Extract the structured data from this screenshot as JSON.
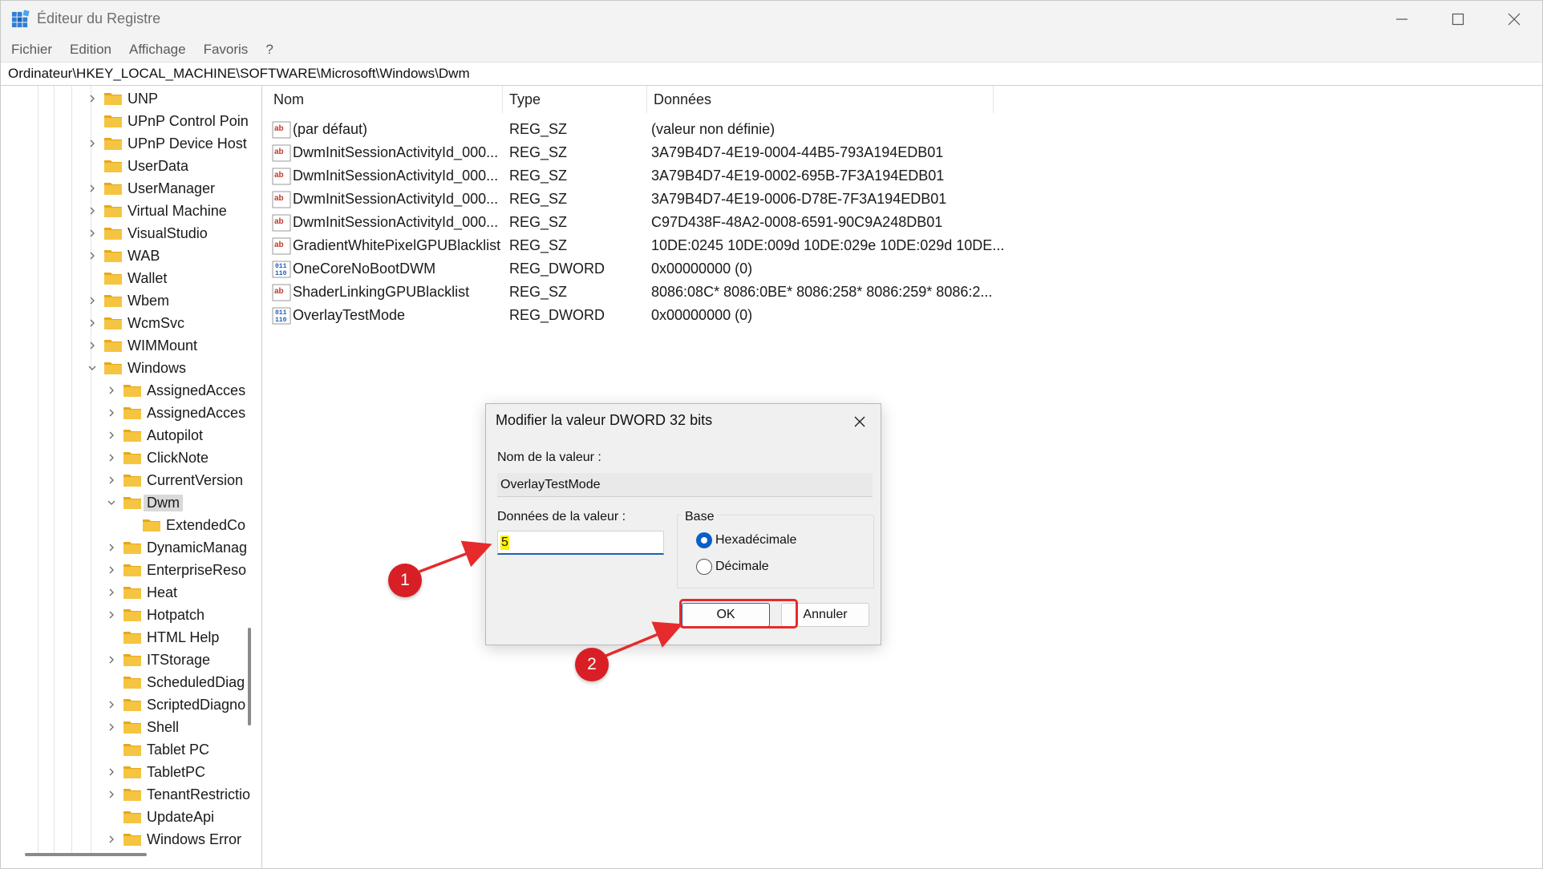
{
  "window": {
    "title": "Éditeur du Registre"
  },
  "menu": [
    "Fichier",
    "Edition",
    "Affichage",
    "Favoris",
    "?"
  ],
  "address": "Ordinateur\\HKEY_LOCAL_MACHINE\\SOFTWARE\\Microsoft\\Windows\\Dwm",
  "tree": {
    "items": [
      {
        "label": "UNP",
        "expandable": true
      },
      {
        "label": "UPnP Control Poin",
        "expandable": false
      },
      {
        "label": "UPnP Device Host",
        "expandable": true
      },
      {
        "label": "UserData",
        "expandable": false
      },
      {
        "label": "UserManager",
        "expandable": true
      },
      {
        "label": "Virtual Machine",
        "expandable": true
      },
      {
        "label": "VisualStudio",
        "expandable": true
      },
      {
        "label": "WAB",
        "expandable": true
      },
      {
        "label": "Wallet",
        "expandable": false
      },
      {
        "label": "Wbem",
        "expandable": true
      },
      {
        "label": "WcmSvc",
        "expandable": true
      },
      {
        "label": "WIMMount",
        "expandable": true
      },
      {
        "label": "Windows",
        "expandable": true,
        "expanded": true
      },
      {
        "label": "AssignedAcces",
        "expandable": true
      },
      {
        "label": "AssignedAcces",
        "expandable": true
      },
      {
        "label": "Autopilot",
        "expandable": true
      },
      {
        "label": "ClickNote",
        "expandable": true
      },
      {
        "label": "CurrentVersion",
        "expandable": true
      },
      {
        "label": "Dwm",
        "expandable": true,
        "expanded": true,
        "selected": true
      },
      {
        "label": "ExtendedCo",
        "expandable": false
      },
      {
        "label": "DynamicManag",
        "expandable": true
      },
      {
        "label": "EnterpriseReso",
        "expandable": true
      },
      {
        "label": "Heat",
        "expandable": true
      },
      {
        "label": "Hotpatch",
        "expandable": true
      },
      {
        "label": "HTML Help",
        "expandable": false
      },
      {
        "label": "ITStorage",
        "expandable": true
      },
      {
        "label": "ScheduledDiag",
        "expandable": false
      },
      {
        "label": "ScriptedDiagno",
        "expandable": true
      },
      {
        "label": "Shell",
        "expandable": true
      },
      {
        "label": "Tablet PC",
        "expandable": false
      },
      {
        "label": "TabletPC",
        "expandable": true
      },
      {
        "label": "TenantRestrictio",
        "expandable": true
      },
      {
        "label": "UpdateApi",
        "expandable": false
      },
      {
        "label": "Windows Error",
        "expandable": true
      }
    ]
  },
  "values": {
    "headers": {
      "name": "Nom",
      "type": "Type",
      "data": "Données"
    },
    "rows": [
      {
        "name": "(par défaut)",
        "type": "REG_SZ",
        "data": "(valeur non définie)",
        "icon": "string-value-icon"
      },
      {
        "name": "DwmInitSessionActivityId_000...",
        "type": "REG_SZ",
        "data": "3A79B4D7-4E19-0004-44B5-793A194EDB01",
        "icon": "string-value-icon"
      },
      {
        "name": "DwmInitSessionActivityId_000...",
        "type": "REG_SZ",
        "data": "3A79B4D7-4E19-0002-695B-7F3A194EDB01",
        "icon": "string-value-icon"
      },
      {
        "name": "DwmInitSessionActivityId_000...",
        "type": "REG_SZ",
        "data": "3A79B4D7-4E19-0006-D78E-7F3A194EDB01",
        "icon": "string-value-icon"
      },
      {
        "name": "DwmInitSessionActivityId_000...",
        "type": "REG_SZ",
        "data": "C97D438F-48A2-0008-6591-90C9A248DB01",
        "icon": "string-value-icon"
      },
      {
        "name": "GradientWhitePixelGPUBlacklist",
        "type": "REG_SZ",
        "data": "10DE:0245 10DE:009d 10DE:029e 10DE:029d 10DE...",
        "icon": "string-value-icon"
      },
      {
        "name": "OneCoreNoBootDWM",
        "type": "REG_DWORD",
        "data": "0x00000000 (0)",
        "icon": "binary-value-icon"
      },
      {
        "name": "ShaderLinkingGPUBlacklist",
        "type": "REG_SZ",
        "data": "8086:08C* 8086:0BE* 8086:258* 8086:259* 8086:2...",
        "icon": "string-value-icon"
      },
      {
        "name": "OverlayTestMode",
        "type": "REG_DWORD",
        "data": "0x00000000 (0)",
        "icon": "binary-value-icon"
      }
    ]
  },
  "dialog": {
    "title": "Modifier la valeur DWORD 32 bits",
    "name_label": "Nom de la valeur :",
    "name_value": "OverlayTestMode",
    "data_label": "Données de la valeur :",
    "data_value": "5",
    "base_label": "Base",
    "radio_hex": "Hexadécimale",
    "radio_dec": "Décimale",
    "selected_base": "hex",
    "ok_label": "OK",
    "cancel_label": "Annuler"
  },
  "annotations": {
    "badge1": "1",
    "badge2": "2",
    "color": "#d81f26"
  },
  "colors": {
    "accent": "#0a5fc8",
    "folder": "#f5c441",
    "highlight": "#fff200"
  }
}
